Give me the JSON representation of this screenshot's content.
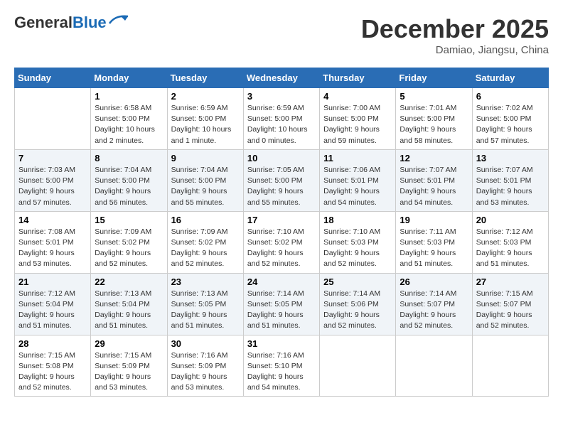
{
  "header": {
    "logo_line1": "General",
    "logo_line2": "Blue",
    "month": "December 2025",
    "location": "Damiao, Jiangsu, China"
  },
  "weekdays": [
    "Sunday",
    "Monday",
    "Tuesday",
    "Wednesday",
    "Thursday",
    "Friday",
    "Saturday"
  ],
  "weeks": [
    [
      {
        "day": "",
        "info": ""
      },
      {
        "day": "1",
        "info": "Sunrise: 6:58 AM\nSunset: 5:00 PM\nDaylight: 10 hours\nand 2 minutes."
      },
      {
        "day": "2",
        "info": "Sunrise: 6:59 AM\nSunset: 5:00 PM\nDaylight: 10 hours\nand 1 minute."
      },
      {
        "day": "3",
        "info": "Sunrise: 6:59 AM\nSunset: 5:00 PM\nDaylight: 10 hours\nand 0 minutes."
      },
      {
        "day": "4",
        "info": "Sunrise: 7:00 AM\nSunset: 5:00 PM\nDaylight: 9 hours\nand 59 minutes."
      },
      {
        "day": "5",
        "info": "Sunrise: 7:01 AM\nSunset: 5:00 PM\nDaylight: 9 hours\nand 58 minutes."
      },
      {
        "day": "6",
        "info": "Sunrise: 7:02 AM\nSunset: 5:00 PM\nDaylight: 9 hours\nand 57 minutes."
      }
    ],
    [
      {
        "day": "7",
        "info": "Sunrise: 7:03 AM\nSunset: 5:00 PM\nDaylight: 9 hours\nand 57 minutes."
      },
      {
        "day": "8",
        "info": "Sunrise: 7:04 AM\nSunset: 5:00 PM\nDaylight: 9 hours\nand 56 minutes."
      },
      {
        "day": "9",
        "info": "Sunrise: 7:04 AM\nSunset: 5:00 PM\nDaylight: 9 hours\nand 55 minutes."
      },
      {
        "day": "10",
        "info": "Sunrise: 7:05 AM\nSunset: 5:00 PM\nDaylight: 9 hours\nand 55 minutes."
      },
      {
        "day": "11",
        "info": "Sunrise: 7:06 AM\nSunset: 5:01 PM\nDaylight: 9 hours\nand 54 minutes."
      },
      {
        "day": "12",
        "info": "Sunrise: 7:07 AM\nSunset: 5:01 PM\nDaylight: 9 hours\nand 54 minutes."
      },
      {
        "day": "13",
        "info": "Sunrise: 7:07 AM\nSunset: 5:01 PM\nDaylight: 9 hours\nand 53 minutes."
      }
    ],
    [
      {
        "day": "14",
        "info": "Sunrise: 7:08 AM\nSunset: 5:01 PM\nDaylight: 9 hours\nand 53 minutes."
      },
      {
        "day": "15",
        "info": "Sunrise: 7:09 AM\nSunset: 5:02 PM\nDaylight: 9 hours\nand 52 minutes."
      },
      {
        "day": "16",
        "info": "Sunrise: 7:09 AM\nSunset: 5:02 PM\nDaylight: 9 hours\nand 52 minutes."
      },
      {
        "day": "17",
        "info": "Sunrise: 7:10 AM\nSunset: 5:02 PM\nDaylight: 9 hours\nand 52 minutes."
      },
      {
        "day": "18",
        "info": "Sunrise: 7:10 AM\nSunset: 5:03 PM\nDaylight: 9 hours\nand 52 minutes."
      },
      {
        "day": "19",
        "info": "Sunrise: 7:11 AM\nSunset: 5:03 PM\nDaylight: 9 hours\nand 51 minutes."
      },
      {
        "day": "20",
        "info": "Sunrise: 7:12 AM\nSunset: 5:03 PM\nDaylight: 9 hours\nand 51 minutes."
      }
    ],
    [
      {
        "day": "21",
        "info": "Sunrise: 7:12 AM\nSunset: 5:04 PM\nDaylight: 9 hours\nand 51 minutes."
      },
      {
        "day": "22",
        "info": "Sunrise: 7:13 AM\nSunset: 5:04 PM\nDaylight: 9 hours\nand 51 minutes."
      },
      {
        "day": "23",
        "info": "Sunrise: 7:13 AM\nSunset: 5:05 PM\nDaylight: 9 hours\nand 51 minutes."
      },
      {
        "day": "24",
        "info": "Sunrise: 7:14 AM\nSunset: 5:05 PM\nDaylight: 9 hours\nand 51 minutes."
      },
      {
        "day": "25",
        "info": "Sunrise: 7:14 AM\nSunset: 5:06 PM\nDaylight: 9 hours\nand 52 minutes."
      },
      {
        "day": "26",
        "info": "Sunrise: 7:14 AM\nSunset: 5:07 PM\nDaylight: 9 hours\nand 52 minutes."
      },
      {
        "day": "27",
        "info": "Sunrise: 7:15 AM\nSunset: 5:07 PM\nDaylight: 9 hours\nand 52 minutes."
      }
    ],
    [
      {
        "day": "28",
        "info": "Sunrise: 7:15 AM\nSunset: 5:08 PM\nDaylight: 9 hours\nand 52 minutes."
      },
      {
        "day": "29",
        "info": "Sunrise: 7:15 AM\nSunset: 5:09 PM\nDaylight: 9 hours\nand 53 minutes."
      },
      {
        "day": "30",
        "info": "Sunrise: 7:16 AM\nSunset: 5:09 PM\nDaylight: 9 hours\nand 53 minutes."
      },
      {
        "day": "31",
        "info": "Sunrise: 7:16 AM\nSunset: 5:10 PM\nDaylight: 9 hours\nand 54 minutes."
      },
      {
        "day": "",
        "info": ""
      },
      {
        "day": "",
        "info": ""
      },
      {
        "day": "",
        "info": ""
      }
    ]
  ]
}
